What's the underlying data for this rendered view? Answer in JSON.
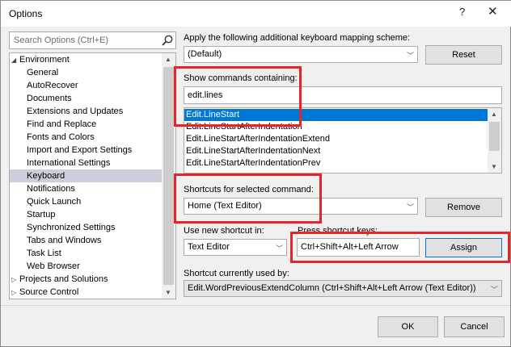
{
  "window": {
    "title": "Options",
    "help_glyph": "?",
    "close_glyph": "✕"
  },
  "search": {
    "placeholder": "Search Options (Ctrl+E)",
    "icon": "search-icon"
  },
  "tree": {
    "items": [
      {
        "label": "Environment",
        "level": 0,
        "expanded": true
      },
      {
        "label": "General",
        "level": 1
      },
      {
        "label": "AutoRecover",
        "level": 1
      },
      {
        "label": "Documents",
        "level": 1
      },
      {
        "label": "Extensions and Updates",
        "level": 1
      },
      {
        "label": "Find and Replace",
        "level": 1
      },
      {
        "label": "Fonts and Colors",
        "level": 1
      },
      {
        "label": "Import and Export Settings",
        "level": 1
      },
      {
        "label": "International Settings",
        "level": 1
      },
      {
        "label": "Keyboard",
        "level": 1,
        "selected": true
      },
      {
        "label": "Notifications",
        "level": 1
      },
      {
        "label": "Quick Launch",
        "level": 1
      },
      {
        "label": "Startup",
        "level": 1
      },
      {
        "label": "Synchronized Settings",
        "level": 1
      },
      {
        "label": "Tabs and Windows",
        "level": 1
      },
      {
        "label": "Task List",
        "level": 1
      },
      {
        "label": "Web Browser",
        "level": 1
      },
      {
        "label": "Projects and Solutions",
        "level": 0,
        "expanded": false
      },
      {
        "label": "Source Control",
        "level": 0,
        "expanded": false
      }
    ]
  },
  "mapping": {
    "label": "Apply the following additional keyboard mapping scheme:",
    "value": "(Default)",
    "reset_label": "Reset"
  },
  "show_commands": {
    "label": "Show commands containing:",
    "value": "edit.lines"
  },
  "commands": {
    "items": [
      {
        "label": "Edit.LineStart",
        "selected": true
      },
      {
        "label": "Edit.LineStartAfterIndentation"
      },
      {
        "label": "Edit.LineStartAfterIndentationExtend"
      },
      {
        "label": "Edit.LineStartAfterIndentationNext"
      },
      {
        "label": "Edit.LineStartAfterIndentationPrev"
      }
    ]
  },
  "shortcuts_selected": {
    "label": "Shortcuts for selected command:",
    "value": "Home (Text Editor)",
    "remove_label": "Remove"
  },
  "use_shortcut": {
    "label": "Use new shortcut in:",
    "value": "Text Editor"
  },
  "press_keys": {
    "label": "Press shortcut keys:",
    "value": "Ctrl+Shift+Alt+Left Arrow",
    "assign_label": "Assign"
  },
  "currently_used": {
    "label": "Shortcut currently used by:",
    "value": "Edit.WordPreviousExtendColumn (Ctrl+Shift+Alt+Left Arrow (Text Editor))"
  },
  "footer": {
    "ok_label": "OK",
    "cancel_label": "Cancel"
  },
  "colors": {
    "highlight_box": "#e8242b",
    "selection": "#0078d7",
    "tree_selection": "#cccedb"
  }
}
